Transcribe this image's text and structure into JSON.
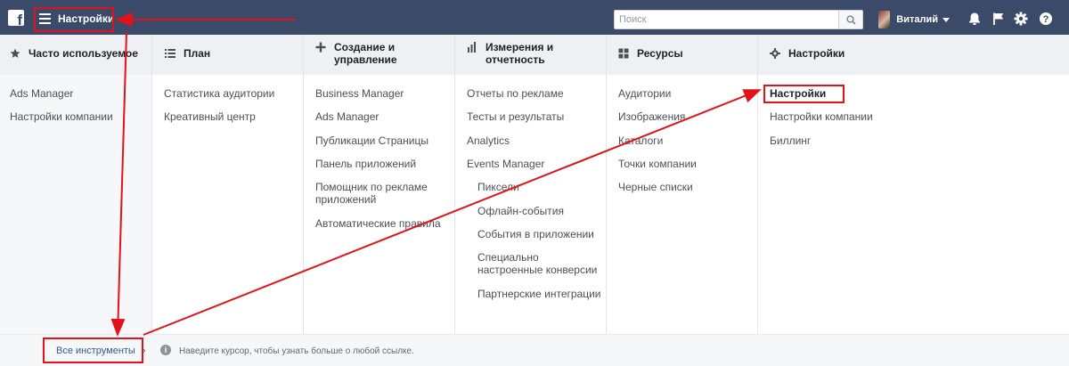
{
  "topbar": {
    "logo_letter": "f",
    "menu_title": "Настройки",
    "search_placeholder": "Поиск",
    "user_name": "Виталий"
  },
  "columns": [
    {
      "title": "Часто используемое",
      "icon": "star-icon",
      "items": [
        "Ads Manager",
        "Настройки компании"
      ]
    },
    {
      "title": "План",
      "icon": "list-icon",
      "items": [
        "Статистика аудитории",
        "Креативный центр"
      ]
    },
    {
      "title": "Создание и управление",
      "icon": "plus-icon",
      "items": [
        "Business Manager",
        "Ads Manager",
        "Публикации Страницы",
        "Панель приложений",
        "Помощник по рекламе приложений",
        "Автоматические правила"
      ]
    },
    {
      "title": "Измерения и отчетность",
      "icon": "bar-chart-icon",
      "items": [
        "Отчеты по рекламе",
        "Тесты и результаты",
        "Analytics",
        "Events Manager"
      ],
      "subitems": [
        "Пиксели",
        "Офлайн-события",
        "События в приложении",
        "Специально настроенные конверсии",
        "Партнерские интеграции"
      ]
    },
    {
      "title": "Ресурсы",
      "icon": "grid-icon",
      "items": [
        "Аудитории",
        "Изображения",
        "Каталоги",
        "Точки компании",
        "Черные списки"
      ]
    },
    {
      "title": "Настройки",
      "icon": "gear-icon",
      "items": [
        "Настройки",
        "Настройки компании",
        "Биллинг"
      ]
    }
  ],
  "footer": {
    "all_tools": "Все инструменты",
    "hint": "Наведите курсор, чтобы узнать больше о любой ссылке."
  },
  "colors": {
    "topbar": "#3b4a68",
    "annotation": "#e3121a",
    "link": "#365899"
  }
}
